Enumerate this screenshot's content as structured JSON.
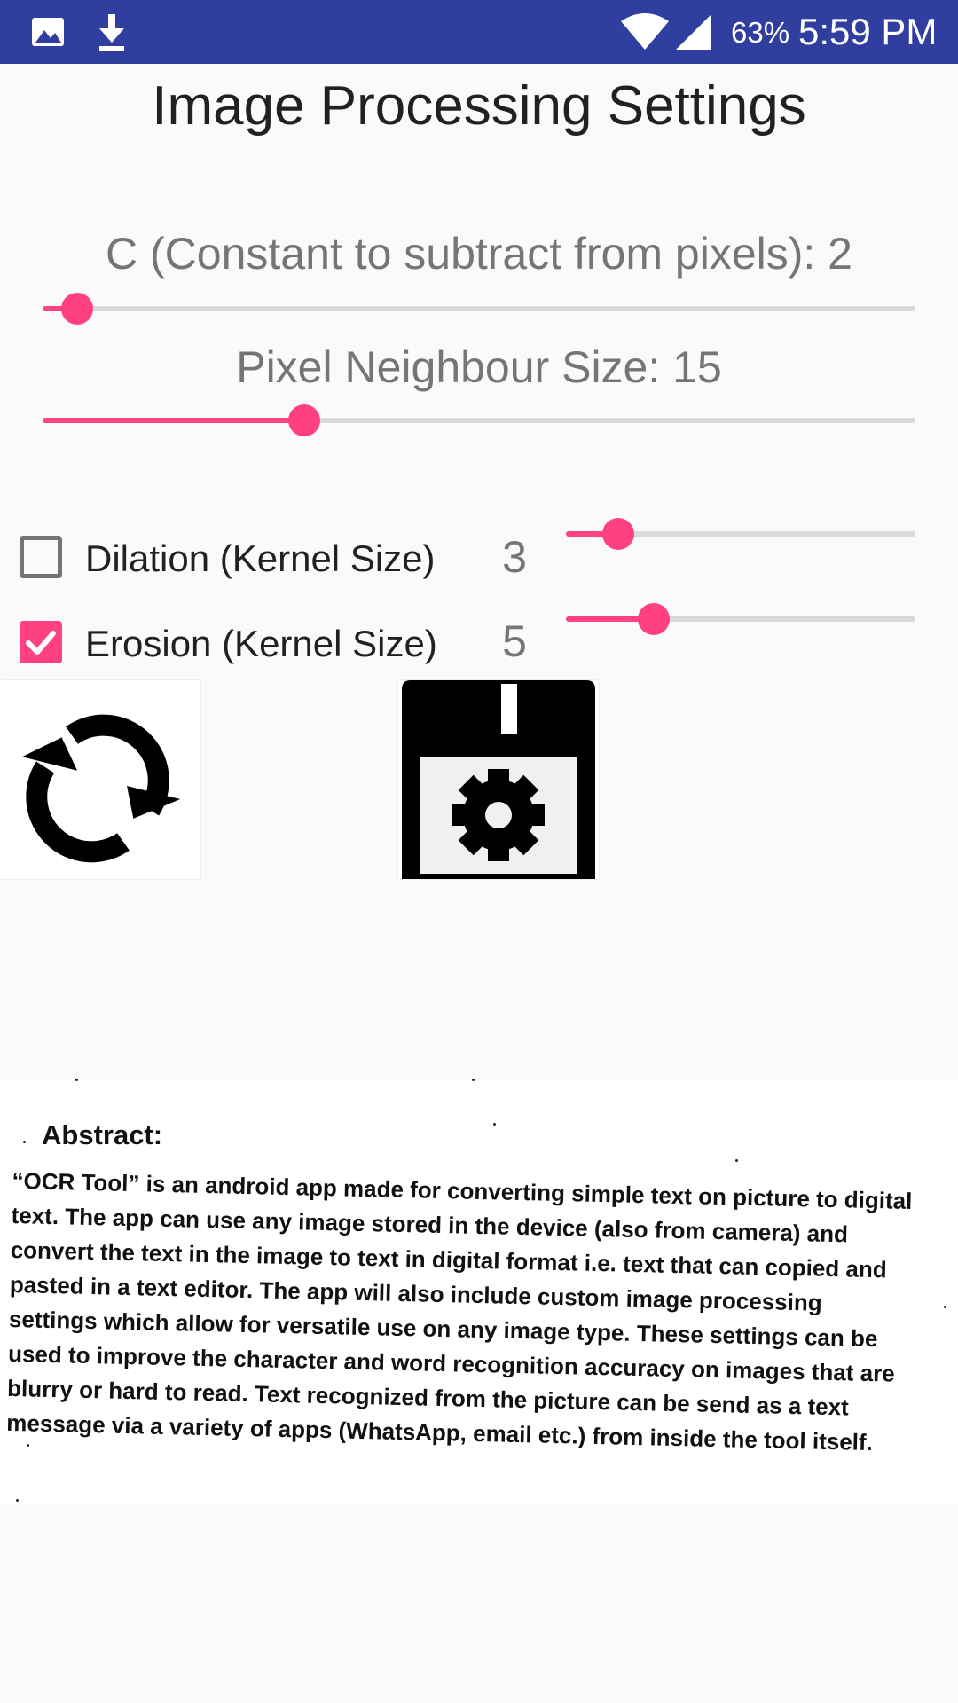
{
  "status_bar": {
    "icons": [
      "image-icon",
      "download-icon",
      "wifi-icon",
      "cell-signal-icon"
    ],
    "battery": "63%",
    "time": "5:59 PM",
    "background_color": "#303f9f"
  },
  "screen": {
    "title": "Image Processing Settings",
    "accent_color": "#ff4081"
  },
  "sliders": {
    "c_constant": {
      "label": "C (Constant to subtract from pixels): 2",
      "fraction": 0.04
    },
    "neighbour_size": {
      "label": "Pixel Neighbour Size: 15",
      "fraction": 0.3
    }
  },
  "morphology": {
    "dilation": {
      "label": "Dilation (Kernel Size)",
      "value": "3",
      "checked": false,
      "fraction": 0.15
    },
    "erosion": {
      "label": "Erosion (Kernel Size)",
      "value": "5",
      "checked": true,
      "fraction": 0.25
    }
  },
  "buttons": {
    "refresh_icon": "refresh-icon",
    "save_settings_icon": "save-settings-icon"
  },
  "preview": {
    "heading": "Abstract:",
    "body": "“OCR Tool” is an android app made for converting simple text on picture to digital text. The app can use any image stored in the device (also from camera) and convert the text in the image to text in digital format i.e. text that can copied and pasted in a text editor. The app will also include custom image processing settings which allow for versatile use on any image type. These settings can be used to improve the character and word recognition accuracy on images that are blurry or hard to read. Text recognized from the picture can be send as a text message via a variety of apps (WhatsApp, email etc.) from inside the tool itself."
  }
}
